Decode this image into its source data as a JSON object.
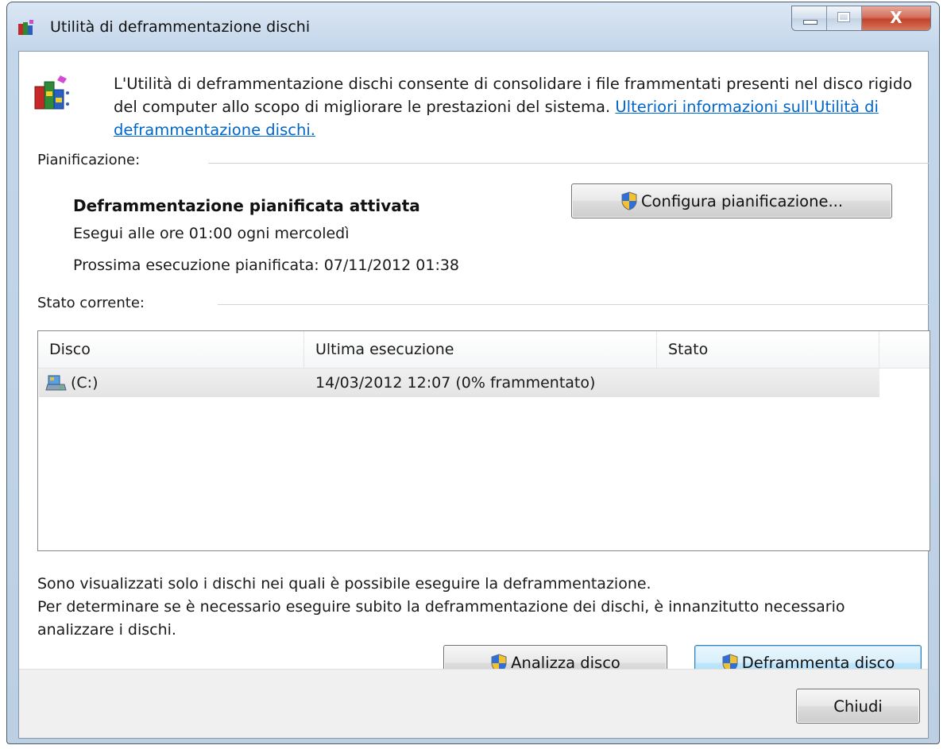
{
  "window": {
    "title": "Utilità di deframmentazione dischi",
    "close_glyph": "X"
  },
  "intro": {
    "text": "L'Utilità di deframmentazione dischi consente di consolidare i file frammentati presenti nel disco rigido del computer allo scopo di migliorare le prestazioni del sistema. ",
    "link": "Ulteriori informazioni sull'Utilità di deframmentazione dischi."
  },
  "schedule": {
    "section_label": "Pianificazione:",
    "status": "Deframmentazione pianificata attivata",
    "run_at": "Esegui alle ore 01:00 ogni mercoledì",
    "next_run": "Prossima esecuzione pianificata: 07/11/2012 01:38",
    "configure_label": "Configura pianificazione..."
  },
  "current": {
    "section_label": "Stato corrente:",
    "columns": [
      "Disco",
      "Ultima esecuzione",
      "Stato"
    ],
    "rows": [
      {
        "disk": "(C:)",
        "last_run": "14/03/2012 12:07 (0% frammentato)",
        "status": ""
      }
    ]
  },
  "notes": {
    "line1": "Sono visualizzati solo i dischi nei quali è possibile eseguire la deframmentazione.",
    "line2": "Per determinare se è necessario eseguire subito la deframmentazione dei dischi, è innanzitutto necessario analizzare i dischi."
  },
  "buttons": {
    "analyze": "Analizza disco",
    "defrag": "Deframmenta disco",
    "close": "Chiudi"
  },
  "colors": {
    "link": "#0066cc",
    "close_button": "#c0432a"
  },
  "icons": {
    "app": "defrag-icon",
    "shield": "uac-shield-icon",
    "drive": "hard-drive-icon"
  }
}
